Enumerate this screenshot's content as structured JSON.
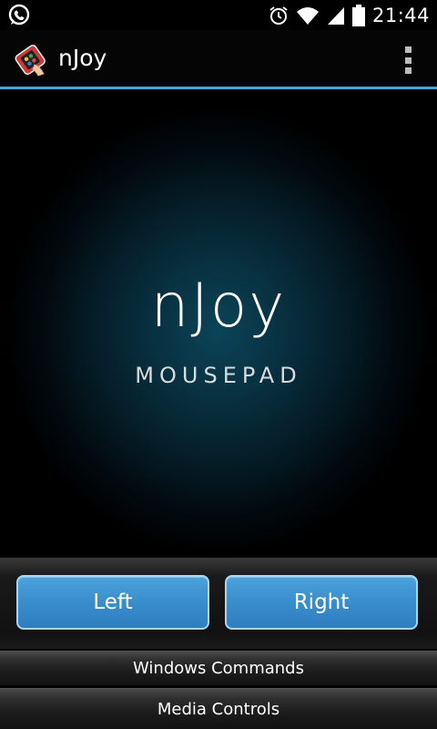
{
  "status_bar": {
    "time": "21:44",
    "icons": [
      "whatsapp-icon",
      "alarm-icon",
      "wifi-icon",
      "signal-icon",
      "battery-icon"
    ]
  },
  "action_bar": {
    "title": "nJoy",
    "logo": "njoy-gamepad-logo",
    "menu_icon": "overflow-menu-icon"
  },
  "mousepad": {
    "brand_title": "nJoy",
    "brand_subtitle": "MOUSEPAD"
  },
  "buttons": {
    "left_label": "Left",
    "right_label": "Right"
  },
  "panels": {
    "windows_label": "Windows Commands",
    "media_label": "Media Controls"
  },
  "colors": {
    "accent": "#4aa3d6",
    "button_blue": "#3a8fcd",
    "button_border": "#a9d7f2",
    "glow": "#0b4457"
  }
}
